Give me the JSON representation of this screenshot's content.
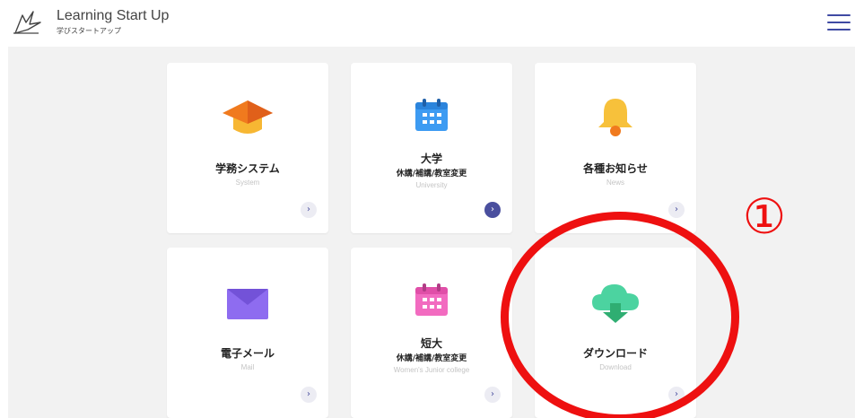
{
  "header": {
    "app_title": "Learning Start Up",
    "app_subtitle": "学びスタートアップ",
    "logo_icon": "star-book-icon",
    "menu_icon": "hamburger-menu-icon"
  },
  "cards": [
    {
      "title": "学務システム",
      "subtitle": "",
      "english": "System",
      "icon": "graduation-cap-icon",
      "arrow": "›"
    },
    {
      "title": "大学",
      "subtitle": "休講/補講/教室変更",
      "english": "University",
      "icon": "calendar-blue-icon",
      "arrow": "›"
    },
    {
      "title": "各種お知らせ",
      "subtitle": "",
      "english": "News",
      "icon": "bell-icon",
      "arrow": "›"
    },
    {
      "title": "電子メール",
      "subtitle": "",
      "english": "Mail",
      "icon": "envelope-icon",
      "arrow": "›"
    },
    {
      "title": "短大",
      "subtitle": "休講/補講/教室変更",
      "english": "Women's Junior college",
      "icon": "calendar-pink-icon",
      "arrow": "›"
    },
    {
      "title": "ダウンロード",
      "subtitle": "",
      "english": "Download",
      "icon": "cloud-download-icon",
      "arrow": "›"
    }
  ],
  "annotation": {
    "label": "①",
    "color": "#ee1010"
  },
  "colors": {
    "accent": "#4a4f9e",
    "cap_orange": "#f07a1e",
    "calendar_blue": "#3d9bf2",
    "bell_yellow": "#f7c13b",
    "mail_purple": "#8e6cf0",
    "calendar_pink": "#f26bc0",
    "cloud_green": "#4cd3a0"
  }
}
